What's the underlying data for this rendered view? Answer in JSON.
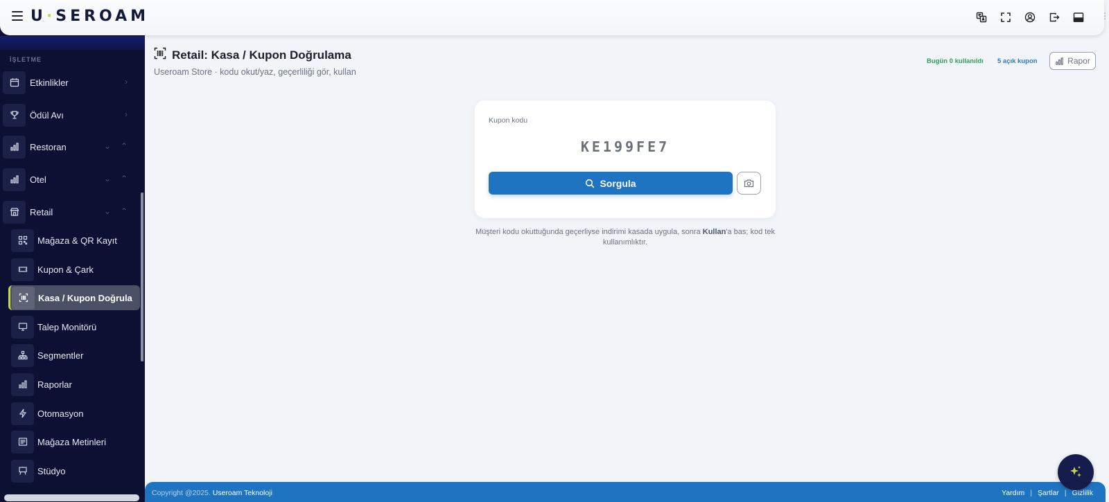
{
  "app": {
    "logo_text": "USEROAM"
  },
  "sidebar": {
    "section_label": "İŞLETME",
    "items": [
      {
        "label": "Etkinlikler",
        "icon": "calendar-icon"
      },
      {
        "label": "Ödül Avı",
        "icon": "trophy-icon"
      },
      {
        "label": "Restoran",
        "icon": "chart-icon"
      },
      {
        "label": "Otel",
        "icon": "chart-icon"
      },
      {
        "label": "Retail",
        "icon": "store-icon"
      }
    ],
    "sub_items": [
      {
        "label": "Mağaza & QR Kayıt",
        "icon": "qr-icon"
      },
      {
        "label": "Kupon & Çark",
        "icon": "ticket-icon"
      },
      {
        "label": "Kasa / Kupon Doğrula",
        "icon": "barcode-scan-icon"
      },
      {
        "label": "Talep Monitörü",
        "icon": "monitor-icon"
      },
      {
        "label": "Segmentler",
        "icon": "hierarchy-icon"
      },
      {
        "label": "Raporlar",
        "icon": "bar-chart-icon"
      },
      {
        "label": "Otomasyon",
        "icon": "bolt-icon"
      },
      {
        "label": "Mağaza Metinleri",
        "icon": "text-icon"
      },
      {
        "label": "Stüdyo",
        "icon": "easel-icon"
      }
    ]
  },
  "page": {
    "title": "Retail: Kasa / Kupon Doğrulama",
    "subtitle": "Useroam Store · kodu okut/yaz, geçerliliği gör, kullan",
    "stat_used_today": "Bugün 0 kullanıldı",
    "stat_open_coupons": "5 açık kupon",
    "report_button": "Rapor"
  },
  "card": {
    "label": "Kupon kodu",
    "coupon_value": "KE199FE7",
    "search_button": "Sorgula"
  },
  "help": {
    "before": "Müşteri kodu okuttuğunda geçerliyse indirimi kasada uygula, sonra ",
    "bold": "Kullan",
    "after": "'a bas; kod tek kullanımlıktır."
  },
  "footer": {
    "copyright": "Copyright @2025.",
    "company": "Useroam Teknoloji",
    "links": [
      "Yardım",
      "Şartlar",
      "Gizlilik"
    ]
  },
  "colors": {
    "sidebar_bg": "#0c1033",
    "primary": "#1f74c1",
    "accent": "#c4d64a",
    "stat_green": "#2e9e57",
    "stat_blue": "#2b7bc4"
  }
}
